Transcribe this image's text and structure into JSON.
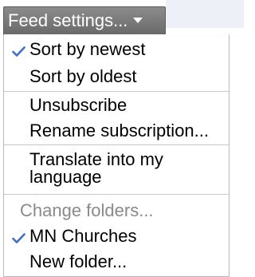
{
  "button": {
    "label": "Feed settings...",
    "caret_icon": "caret-down-icon"
  },
  "menu": {
    "sort_newest": {
      "label": "Sort by newest",
      "checked": true
    },
    "sort_oldest": {
      "label": "Sort by oldest",
      "checked": false
    },
    "unsubscribe": {
      "label": "Unsubscribe"
    },
    "rename": {
      "label": "Rename subscription..."
    },
    "translate": {
      "label": "Translate into my language"
    },
    "change_folders": {
      "label": "Change folders...",
      "disabled": true
    },
    "folder_mn": {
      "label": "MN Churches",
      "checked": true
    },
    "new_folder": {
      "label": "New folder..."
    }
  },
  "colors": {
    "button_bg": "#777777",
    "checkmark": "#3b6fc8",
    "disabled_text": "#8a8a8a",
    "separator": "#c8c8c8"
  }
}
